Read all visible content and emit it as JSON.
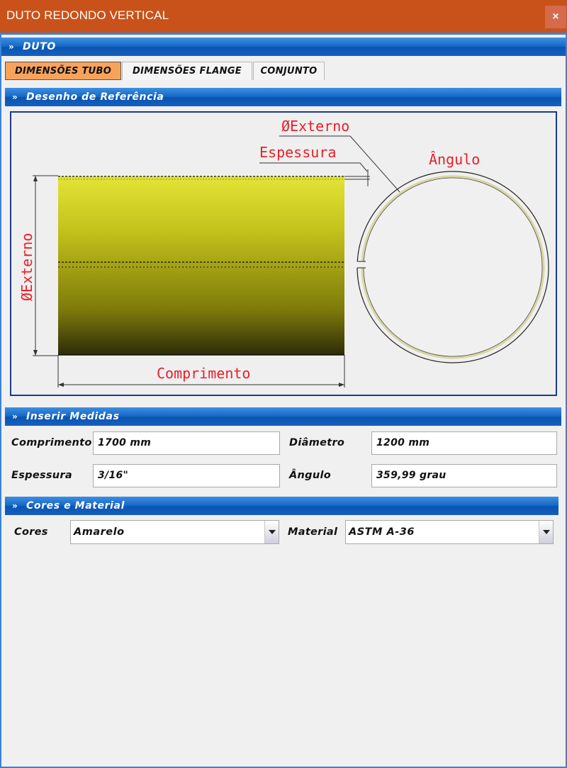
{
  "window": {
    "title": "DUTO REDONDO VERTICAL",
    "close_label": "×"
  },
  "sections": {
    "duto": "DUTO",
    "reference": "Desenho de Referência",
    "measures": "Inserir Medidas",
    "colors": "Cores e Material"
  },
  "tabs": [
    {
      "label": "DIMENSÕES TUBO",
      "active": true
    },
    {
      "label": "DIMENSÕES FLANGE",
      "active": false
    },
    {
      "label": "CONJUNTO",
      "active": false
    }
  ],
  "drawing": {
    "label_diameter_top": "ØExterno",
    "label_thickness": "Espessura",
    "label_angle": "Ângulo",
    "label_diameter_side": "ØExterno",
    "label_length": "Comprimento",
    "tube_color": "#c4c21c",
    "dimension_color": "#e8202a"
  },
  "measures": {
    "length_label": "Comprimento",
    "length_value": "1700 mm",
    "diameter_label": "Diâmetro",
    "diameter_value": "1200 mm",
    "thickness_label": "Espessura",
    "thickness_value": "3/16\"",
    "angle_label": "Ângulo",
    "angle_value": "359,99 grau"
  },
  "colors": {
    "color_label": "Cores",
    "color_value": "Amarelo",
    "material_label": "Material",
    "material_value": "ASTM A-36"
  },
  "icons": {
    "section_toggle": "chevron-double-down-icon",
    "dropdown": "dropdown-arrow-icon"
  }
}
